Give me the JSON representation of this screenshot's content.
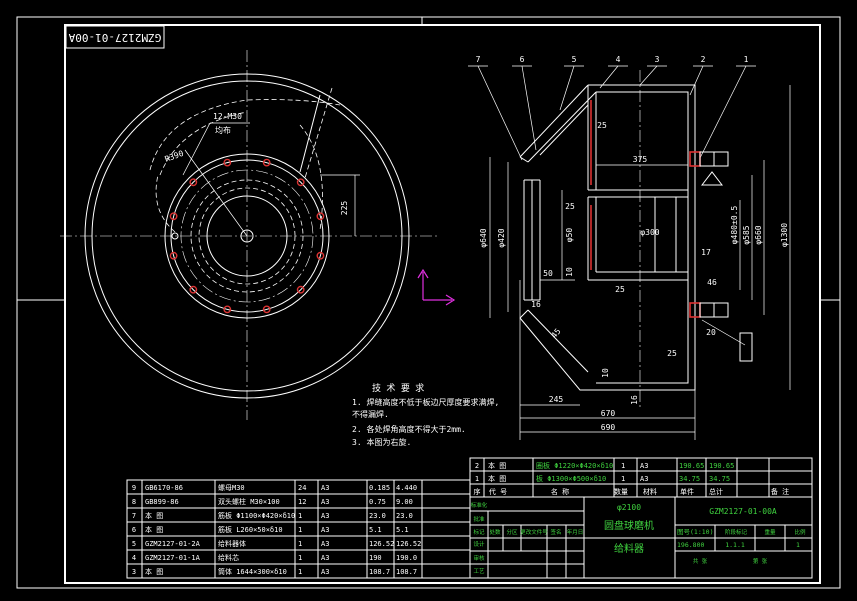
{
  "drawing": {
    "code_rotated": "GZM2127-01-00A",
    "bolt_label": "12-M30",
    "bolt_note": "均布",
    "radius_label": "R390",
    "dim_225": "225"
  },
  "section_view": {
    "part_refs": [
      "7",
      "6",
      "5",
      "4",
      "3",
      "2",
      "1"
    ],
    "dims": {
      "d640": "φ640",
      "d420": "φ420",
      "d50": "φ50",
      "d300": "φ300",
      "d480": "φ480±0.5",
      "d585": "φ585",
      "d660": "φ660",
      "d1300": "φ1300",
      "w375": "375",
      "t25a": "25",
      "t25b": "25",
      "t25c": "25",
      "t25d": "25",
      "t10a": "10",
      "t10b": "10",
      "w50": "50",
      "t16a": "16",
      "t16b": "16",
      "t17": "17",
      "t20": "20",
      "w245": "245",
      "w670": "670",
      "w690": "690",
      "a45": "45",
      "h46": "46"
    }
  },
  "tech_req": {
    "title": "技 术 要 求",
    "items": [
      "1. 焊缝高度不低于板边尺厚度要求满焊,",
      "   不得漏焊.",
      "2. 各处焊角高度不得大于2mm.",
      "3. 本图为右旋."
    ]
  },
  "bom": {
    "rows": [
      {
        "no": "9",
        "code": "GB6170-86",
        "name": "螺母M30",
        "qty": "24",
        "mat": "A3",
        "unit": "0.185",
        "total": "4.440"
      },
      {
        "no": "8",
        "code": "GB899-86",
        "name": "双头螺柱 M30×100",
        "qty": "12",
        "mat": "A3",
        "unit": "0.75",
        "total": "9.00"
      },
      {
        "no": "7",
        "code": "本    图",
        "name": "筋板 Φ1100×Φ420×δ10",
        "qty": "1",
        "mat": "A3",
        "unit": "23.0",
        "total": "23.0"
      },
      {
        "no": "6",
        "code": "本    图",
        "name": "筋板 L260×50×δ10",
        "qty": "1",
        "mat": "A3",
        "unit": "5.1",
        "total": "5.1"
      },
      {
        "no": "5",
        "code": "GZM2127-01-2A",
        "name": "给料器体",
        "qty": "1",
        "mat": "A3",
        "unit": "126.52",
        "total": "126.52"
      },
      {
        "no": "4",
        "code": "GZM2127-01-1A",
        "name": "给料芯",
        "qty": "1",
        "mat": "A3",
        "unit": "190",
        "total": "190.0"
      },
      {
        "no": "3",
        "code": "本    图",
        "name": "筒体 1644×300×δ10",
        "qty": "1",
        "mat": "A3",
        "unit": "108.7",
        "total": "108.7"
      }
    ]
  },
  "title_block": {
    "upper_rows": [
      {
        "no": "2",
        "code": "本    图",
        "name": "圈板 Φ1220×Φ420×δ10",
        "qty": "1",
        "mat": "A3",
        "unit": "190.65",
        "total": "190.65"
      },
      {
        "no": "1",
        "code": "本    图",
        "name": "板 Φ1300×Φ500×δ10",
        "qty": "1",
        "mat": "A3",
        "unit": "34.75",
        "total": "34.75"
      }
    ],
    "header": [
      "序",
      "代  号",
      "名   称",
      "数量",
      "材料",
      "单件",
      "总计",
      "备  注"
    ],
    "project": "φ2100",
    "machine": "圆盘球磨机",
    "part": "给料器",
    "drawing_no": "GZM2127-01-00A",
    "scale_label": "图号(1:10)",
    "sheet": "1.1.1",
    "weight": "196.800",
    "one": "1",
    "labels": [
      "标记",
      "处数",
      "分区",
      "更改文件号",
      "签名",
      "年月日",
      "设计",
      "标准化",
      "审核",
      "工艺",
      "批准",
      "阶段标记",
      "重量",
      "比例",
      "共  张",
      "第  张"
    ]
  },
  "colors": {
    "line": "#ffffff",
    "text_green": "#3fd23f",
    "hatch": "#dd3333",
    "ucs": "#e030e0"
  }
}
